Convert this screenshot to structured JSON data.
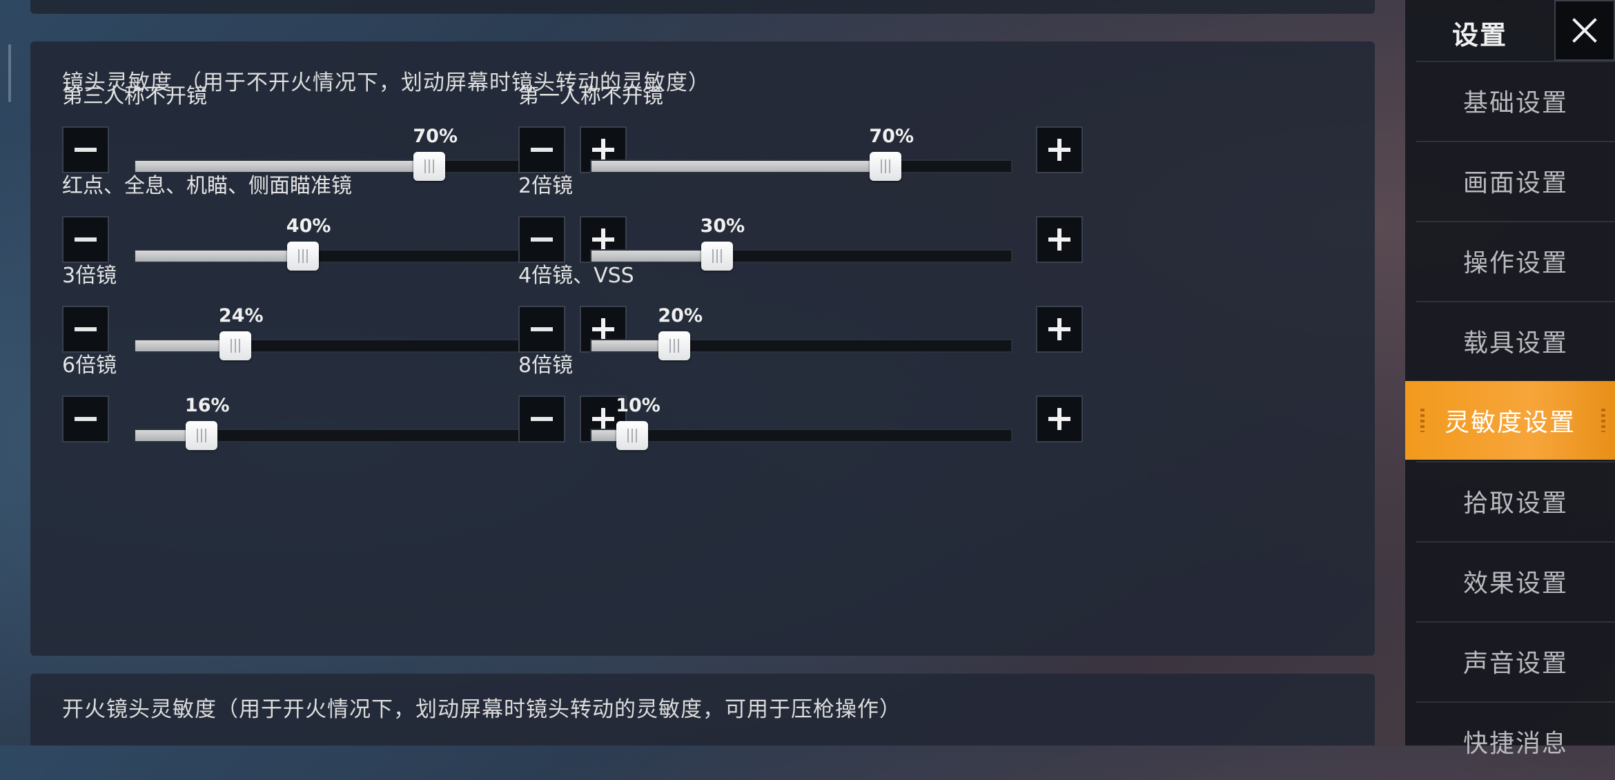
{
  "camera_section": {
    "title": "镜头灵敏度 （用于不开火情况下，划动屏幕时镜头转动的灵敏度）",
    "settings": [
      {
        "label": "第三人称不开镜",
        "value": 70,
        "value_text": "70%"
      },
      {
        "label": "第一人称不开镜",
        "value": 70,
        "value_text": "70%"
      },
      {
        "label": "红点、全息、机瞄、侧面瞄准镜",
        "value": 40,
        "value_text": "40%"
      },
      {
        "label": "2倍镜",
        "value": 30,
        "value_text": "30%"
      },
      {
        "label": "3倍镜",
        "value": 24,
        "value_text": "24%"
      },
      {
        "label": "4倍镜、VSS",
        "value": 20,
        "value_text": "20%"
      },
      {
        "label": "6倍镜",
        "value": 16,
        "value_text": "16%"
      },
      {
        "label": "8倍镜",
        "value": 10,
        "value_text": "10%"
      }
    ],
    "slider_range": [
      0,
      100
    ]
  },
  "fire_section": {
    "title": "开火镜头灵敏度（用于开火情况下，划动屏幕时镜头转动的灵敏度，可用于压枪操作）"
  },
  "sidebar": {
    "title": "设置",
    "close_icon": "close-icon",
    "items": [
      {
        "label": "基础设置",
        "active": false
      },
      {
        "label": "画面设置",
        "active": false
      },
      {
        "label": "操作设置",
        "active": false
      },
      {
        "label": "载具设置",
        "active": false
      },
      {
        "label": "灵敏度设置",
        "active": true
      },
      {
        "label": "拾取设置",
        "active": false
      },
      {
        "label": "效果设置",
        "active": false
      },
      {
        "label": "声音设置",
        "active": false
      },
      {
        "label": "快捷消息",
        "active": false
      }
    ]
  },
  "colors": {
    "accent": "#f29a1d",
    "panel": "#222836",
    "button": "#0c0f14"
  },
  "icons": {
    "minus": "minus-icon",
    "plus": "plus-icon"
  }
}
